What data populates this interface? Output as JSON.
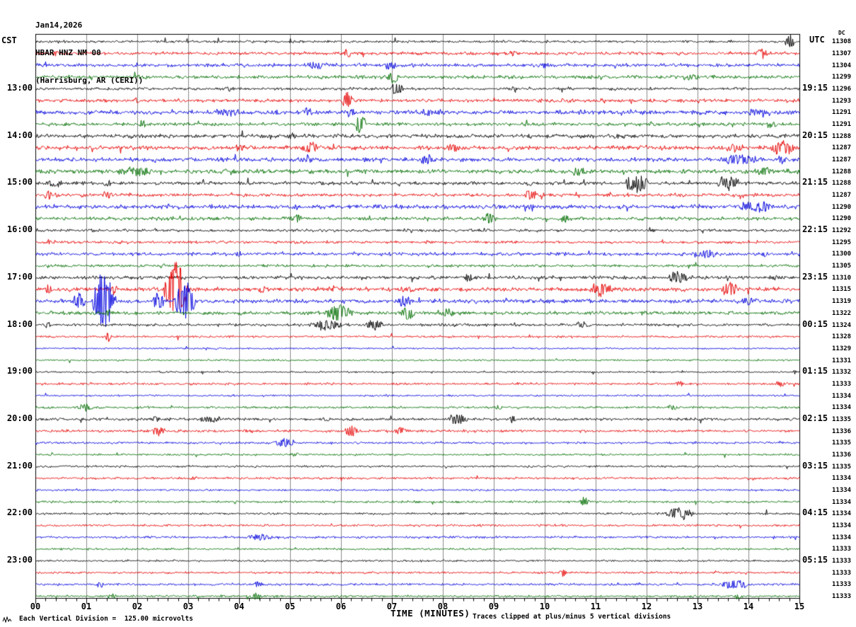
{
  "header": {
    "date": "Jan14,2026",
    "station": "HBAR HNZ NM 00",
    "location": "(Harrisburg, AR (CERI))"
  },
  "axes": {
    "left_timezone": "CST",
    "right_timezone": "UTC",
    "dc_header": "DC",
    "xlabel": "TIME (MINUTES)",
    "x_ticks": [
      "00",
      "01",
      "02",
      "03",
      "04",
      "05",
      "06",
      "07",
      "08",
      "09",
      "10",
      "11",
      "12",
      "13",
      "14",
      "15"
    ],
    "hour_marks": [
      {
        "row": 4,
        "cst": "13:00",
        "utc": "19:15"
      },
      {
        "row": 8,
        "cst": "14:00",
        "utc": "20:15"
      },
      {
        "row": 12,
        "cst": "15:00",
        "utc": "21:15"
      },
      {
        "row": 16,
        "cst": "16:00",
        "utc": "22:15"
      },
      {
        "row": 20,
        "cst": "17:00",
        "utc": "23:15"
      },
      {
        "row": 24,
        "cst": "18:00",
        "utc": "00:15"
      },
      {
        "row": 28,
        "cst": "19:00",
        "utc": "01:15"
      },
      {
        "row": 32,
        "cst": "20:00",
        "utc": "02:15"
      },
      {
        "row": 36,
        "cst": "21:00",
        "utc": "03:15"
      },
      {
        "row": 40,
        "cst": "22:00",
        "utc": "04:15"
      },
      {
        "row": 44,
        "cst": "23:00",
        "utc": "05:15"
      }
    ]
  },
  "footer": {
    "scale_note": "Each Vertical Division =  125.00 microvolts",
    "clip_note": "Traces clipped at plus/minus 5 vertical divisions"
  },
  "colors": {
    "trace_cycle": [
      "#000000",
      "#e60000",
      "#0000dd",
      "#006e00"
    ],
    "grid": "#8a8a8a",
    "border": "#000000",
    "background": "#ffffff"
  },
  "chart_data": {
    "type": "line",
    "kind": "seismogram-helicorder",
    "title": "HBAR HNZ NM 00 (Harrisburg, AR (CERI)) Jan14,2026",
    "xlabel": "TIME (MINUTES)",
    "x_range_minutes": [
      0,
      15
    ],
    "x_tick_interval_minutes": 1,
    "minutes_per_row": 15,
    "clip_divisions": 5,
    "microvolts_per_division": 125.0,
    "rows": [
      {
        "color": 0,
        "dc": 11308,
        "noise": 1.0,
        "events": [
          [
            14.7,
            14.9,
            12
          ]
        ]
      },
      {
        "color": 1,
        "dc": 11307,
        "noise": 1.3,
        "events": [
          [
            0.3,
            0.5,
            4
          ],
          [
            6.0,
            6.2,
            5
          ],
          [
            9.3,
            9.5,
            4
          ],
          [
            14.1,
            14.4,
            7
          ]
        ]
      },
      {
        "color": 2,
        "dc": 11304,
        "noise": 1.4,
        "events": [
          [
            5.3,
            5.7,
            5
          ],
          [
            6.8,
            7.1,
            6
          ],
          [
            9.9,
            10.1,
            3
          ]
        ]
      },
      {
        "color": 3,
        "dc": 11299,
        "noise": 1.4,
        "events": [
          [
            2.0,
            2.2,
            3
          ],
          [
            6.9,
            7.15,
            9
          ],
          [
            12.5,
            13.2,
            3
          ]
        ]
      },
      {
        "color": 0,
        "dc": 11296,
        "noise": 1.1,
        "events": [
          [
            3.7,
            3.9,
            3
          ],
          [
            6.95,
            7.25,
            8
          ],
          [
            9.3,
            9.5,
            3
          ]
        ]
      },
      {
        "color": 1,
        "dc": 11293,
        "noise": 1.4,
        "events": [
          [
            1.9,
            2.1,
            3
          ],
          [
            6.0,
            6.25,
            12
          ],
          [
            10.4,
            10.6,
            3
          ]
        ]
      },
      {
        "color": 2,
        "dc": 11291,
        "noise": 1.7,
        "events": [
          [
            3.4,
            4.1,
            4
          ],
          [
            5.2,
            5.45,
            5
          ],
          [
            6.1,
            6.3,
            7
          ],
          [
            7.4,
            8.1,
            4
          ],
          [
            13.9,
            14.5,
            5
          ]
        ]
      },
      {
        "color": 3,
        "dc": 11291,
        "noise": 1.4,
        "events": [
          [
            2.0,
            2.2,
            4
          ],
          [
            6.25,
            6.5,
            13
          ],
          [
            12.0,
            12.2,
            3
          ],
          [
            14.3,
            14.6,
            4
          ]
        ]
      },
      {
        "color": 0,
        "dc": 11288,
        "noise": 1.6,
        "events": [
          [
            4.9,
            5.15,
            4
          ],
          [
            8.3,
            8.5,
            3
          ],
          [
            11.2,
            11.5,
            3
          ]
        ]
      },
      {
        "color": 1,
        "dc": 11287,
        "noise": 1.7,
        "events": [
          [
            3.9,
            4.1,
            5
          ],
          [
            5.2,
            5.6,
            7
          ],
          [
            8.1,
            8.35,
            6
          ],
          [
            13.5,
            13.9,
            5
          ],
          [
            14.4,
            14.95,
            9
          ]
        ]
      },
      {
        "color": 2,
        "dc": 11287,
        "noise": 1.7,
        "events": [
          [
            5.2,
            5.45,
            6
          ],
          [
            7.5,
            7.85,
            7
          ],
          [
            13.4,
            14.2,
            7
          ],
          [
            14.55,
            14.75,
            5
          ]
        ]
      },
      {
        "color": 3,
        "dc": 11288,
        "noise": 1.7,
        "events": [
          [
            1.6,
            2.35,
            6
          ],
          [
            6.4,
            6.6,
            4
          ],
          [
            10.5,
            10.85,
            6
          ],
          [
            14.1,
            14.5,
            6
          ]
        ]
      },
      {
        "color": 0,
        "dc": 11288,
        "noise": 1.4,
        "events": [
          [
            0.2,
            0.55,
            5
          ],
          [
            1.3,
            1.5,
            4
          ],
          [
            9.6,
            9.8,
            4
          ],
          [
            11.55,
            12.05,
            13
          ],
          [
            13.35,
            13.85,
            11
          ]
        ]
      },
      {
        "color": 1,
        "dc": 11287,
        "noise": 1.4,
        "events": [
          [
            0.15,
            0.35,
            6
          ],
          [
            1.25,
            1.55,
            5
          ],
          [
            5.1,
            5.3,
            3
          ],
          [
            9.55,
            9.85,
            7
          ]
        ]
      },
      {
        "color": 2,
        "dc": 11290,
        "noise": 1.7,
        "events": [
          [
            2.5,
            2.7,
            3
          ],
          [
            5.0,
            5.2,
            4
          ],
          [
            13.75,
            14.55,
            7
          ]
        ]
      },
      {
        "color": 3,
        "dc": 11290,
        "noise": 1.4,
        "events": [
          [
            4.95,
            5.25,
            6
          ],
          [
            8.75,
            9.05,
            7
          ],
          [
            10.25,
            10.55,
            5
          ]
        ]
      },
      {
        "color": 0,
        "dc": 11292,
        "noise": 1.1,
        "events": [
          [
            8.7,
            8.9,
            3
          ],
          [
            12.0,
            12.2,
            3
          ]
        ]
      },
      {
        "color": 1,
        "dc": 11295,
        "noise": 1.1,
        "events": [
          [
            0.2,
            0.4,
            3
          ],
          [
            7.6,
            7.8,
            2
          ]
        ]
      },
      {
        "color": 2,
        "dc": 11300,
        "noise": 1.4,
        "events": [
          [
            3.9,
            4.1,
            4
          ],
          [
            12.85,
            13.45,
            6
          ],
          [
            14.2,
            14.4,
            3
          ]
        ]
      },
      {
        "color": 3,
        "dc": 11305,
        "noise": 1.1,
        "events": [
          [
            2.4,
            2.6,
            3
          ],
          [
            7.9,
            8.1,
            2
          ]
        ]
      },
      {
        "color": 0,
        "dc": 11310,
        "noise": 1.4,
        "events": [
          [
            6.3,
            6.5,
            3
          ],
          [
            8.35,
            8.65,
            5
          ],
          [
            12.4,
            12.85,
            9
          ],
          [
            14.4,
            14.6,
            4
          ]
        ]
      },
      {
        "color": 1,
        "dc": 11315,
        "noise": 1.7,
        "events": [
          [
            0.15,
            0.35,
            5
          ],
          [
            1.45,
            1.65,
            6
          ],
          [
            2.5,
            3.0,
            40
          ],
          [
            4.35,
            4.55,
            5
          ],
          [
            5.7,
            5.95,
            4
          ],
          [
            7.1,
            7.45,
            5
          ],
          [
            10.85,
            11.35,
            9
          ],
          [
            13.45,
            13.8,
            11
          ]
        ]
      },
      {
        "color": 2,
        "dc": 11319,
        "noise": 1.7,
        "events": [
          [
            0.7,
            1.0,
            11
          ],
          [
            1.1,
            1.55,
            40
          ],
          [
            2.25,
            2.55,
            11
          ],
          [
            2.7,
            3.15,
            28
          ],
          [
            7.1,
            7.4,
            9
          ],
          [
            13.85,
            14.15,
            6
          ]
        ]
      },
      {
        "color": 3,
        "dc": 11322,
        "noise": 1.4,
        "events": [
          [
            1.3,
            1.5,
            4
          ],
          [
            5.65,
            6.25,
            11
          ],
          [
            7.15,
            7.45,
            9
          ],
          [
            7.95,
            8.25,
            6
          ]
        ]
      },
      {
        "color": 0,
        "dc": 11324,
        "noise": 1.1,
        "events": [
          [
            0.15,
            0.35,
            4
          ],
          [
            5.35,
            6.05,
            7
          ],
          [
            6.45,
            6.85,
            7
          ],
          [
            10.55,
            10.95,
            4
          ]
        ]
      },
      {
        "color": 1,
        "dc": 11328,
        "noise": 0.9,
        "events": [
          [
            1.35,
            1.5,
            8
          ]
        ]
      },
      {
        "color": 2,
        "dc": 11329,
        "noise": 0.7,
        "events": []
      },
      {
        "color": 3,
        "dc": 11331,
        "noise": 0.7,
        "events": []
      },
      {
        "color": 0,
        "dc": 11332,
        "noise": 0.7,
        "events": [
          [
            14.85,
            14.95,
            3
          ]
        ]
      },
      {
        "color": 1,
        "dc": 11333,
        "noise": 0.9,
        "events": [
          [
            12.55,
            12.75,
            4
          ],
          [
            14.5,
            14.7,
            4
          ]
        ]
      },
      {
        "color": 2,
        "dc": 11334,
        "noise": 0.7,
        "events": [
          [
            6.85,
            7.0,
            2
          ]
        ]
      },
      {
        "color": 3,
        "dc": 11334,
        "noise": 0.9,
        "events": [
          [
            0.75,
            1.15,
            5
          ],
          [
            9.0,
            9.2,
            3
          ],
          [
            12.4,
            12.6,
            4
          ]
        ]
      },
      {
        "color": 0,
        "dc": 11335,
        "noise": 1.1,
        "events": [
          [
            2.25,
            2.45,
            4
          ],
          [
            3.15,
            3.7,
            4
          ],
          [
            5.6,
            5.8,
            3
          ],
          [
            8.05,
            8.5,
            8
          ],
          [
            9.25,
            9.45,
            4
          ]
        ]
      },
      {
        "color": 1,
        "dc": 11336,
        "noise": 1.1,
        "events": [
          [
            2.25,
            2.55,
            6
          ],
          [
            6.05,
            6.35,
            8
          ],
          [
            7.05,
            7.3,
            6
          ]
        ]
      },
      {
        "color": 2,
        "dc": 11335,
        "noise": 0.9,
        "events": [
          [
            4.65,
            5.15,
            6
          ]
        ]
      },
      {
        "color": 3,
        "dc": 11336,
        "noise": 0.8,
        "events": [
          [
            5.0,
            5.2,
            2
          ]
        ]
      },
      {
        "color": 0,
        "dc": 11335,
        "noise": 0.8,
        "events": []
      },
      {
        "color": 1,
        "dc": 11334,
        "noise": 0.9,
        "events": [
          [
            3.0,
            3.2,
            2
          ]
        ]
      },
      {
        "color": 2,
        "dc": 11334,
        "noise": 0.8,
        "events": []
      },
      {
        "color": 3,
        "dc": 11334,
        "noise": 0.9,
        "events": [
          [
            10.65,
            10.9,
            7
          ]
        ]
      },
      {
        "color": 0,
        "dc": 11334,
        "noise": 0.9,
        "events": [
          [
            12.35,
            12.95,
            9
          ]
        ]
      },
      {
        "color": 1,
        "dc": 11334,
        "noise": 0.9,
        "events": []
      },
      {
        "color": 2,
        "dc": 11334,
        "noise": 0.9,
        "events": [
          [
            4.15,
            4.7,
            5
          ]
        ]
      },
      {
        "color": 3,
        "dc": 11333,
        "noise": 0.8,
        "events": []
      },
      {
        "color": 0,
        "dc": 11333,
        "noise": 0.8,
        "events": []
      },
      {
        "color": 1,
        "dc": 11333,
        "noise": 0.9,
        "events": [
          [
            10.25,
            10.45,
            6
          ]
        ]
      },
      {
        "color": 2,
        "dc": 11333,
        "noise": 0.9,
        "events": [
          [
            1.15,
            1.35,
            4
          ],
          [
            4.25,
            4.45,
            4
          ],
          [
            13.4,
            14.05,
            6
          ]
        ]
      },
      {
        "color": 3,
        "dc": 11333,
        "noise": 0.9,
        "events": [
          [
            1.4,
            1.6,
            4
          ],
          [
            4.2,
            4.45,
            5
          ],
          [
            13.7,
            13.9,
            4
          ]
        ]
      }
    ]
  }
}
